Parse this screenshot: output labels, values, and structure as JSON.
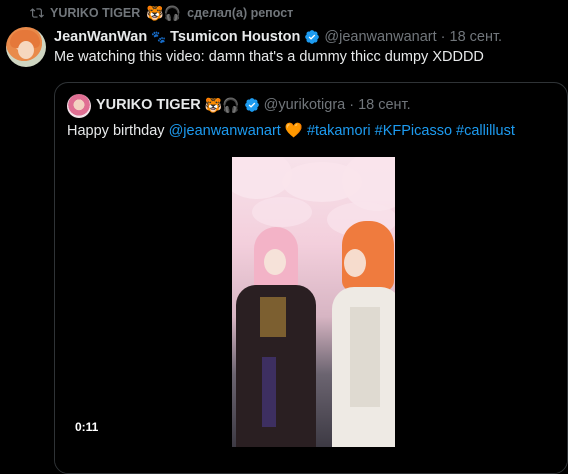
{
  "repost": {
    "user": "YURIKO TIGER",
    "suffix": "сделал(а) репост",
    "emoji": "🐯🎧"
  },
  "tweet": {
    "display_name": "JeanWanWan",
    "display_name_rest": "Tsumicon Houston",
    "handle": "@jeanwanwanart",
    "date": "· 18 сент.",
    "text": "Me watching this video: damn that's a dummy thicc dumpy XDDDD"
  },
  "quote": {
    "display_name": "YURIKO TIGER",
    "emoji": "🐯🎧",
    "handle": "@yurikotigra",
    "date": "· 18 сент.",
    "text_start": "Happy birthday ",
    "mention": "@jeanwanwanart",
    "heart": "🧡",
    "hashtags": "#takamori #KFPicasso #callillust",
    "video_timestamp": "0:11"
  },
  "colors": {
    "accent": "#1d9bf0",
    "muted": "#71767b",
    "text": "#e7e9ea",
    "background": "#000000"
  }
}
